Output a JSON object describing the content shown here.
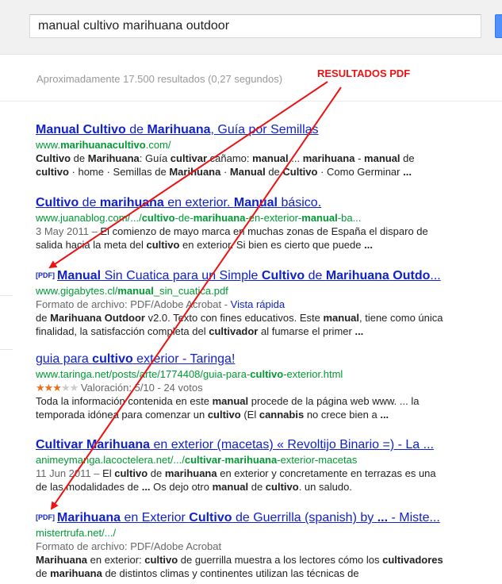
{
  "search": {
    "query": "manual cultivo marihuana outdoor"
  },
  "stats": "Aproximadamente 17.500 resultados (0,27 segundos)",
  "annotation": {
    "label": "RESULTADOS PDF",
    "color": "#ee1111"
  },
  "colors": {
    "title_link": "#1122cc",
    "url_green": "#009933",
    "meta_gray": "#666666"
  },
  "results": [
    {
      "title_html": "<b>Manual Cultivo</b> de <b>Marihuana</b>, Guía por Semillas",
      "url_html": "www.<b>marihuanacultivo</b>.com/",
      "snippet_html": "<b>Cultivo</b> de <b>Marihuana</b>: Guía <b>cultivar</b> cáñamo: <b>manual</b> ... <b>marihuana</b> - <b>manual</b> de <b>cultivo</b> · home · Semillas de <b>Marihuana</b> · <b>Manual</b> de <b>Cultivo</b> · Como Germinar <b>...</b>"
    },
    {
      "title_html": "<b>Cultivo</b> de <b>marihuana</b> en exterior. <b>Manual</b> básico.",
      "url_html": "www.juanablog.com/.../<b>cultivo</b>-de-<b>marihuana</b>-en-exterior-<b>manual</b>-ba...",
      "date": "3 May 2011 – ",
      "snippet_html": "El comienzo de mayo marca en muchas zonas de España el disparo de salida hacia la meta del <b>cultivo</b> en exterior. Si bien es cierto que puede <b>...</b>"
    },
    {
      "pdf_tag": "[PDF]",
      "title_html": "<b>Manual</b> Sin Cuatica para un Simple <b>Cultivo</b> de <b>Marihuana</b> <b>Outdo</b>...",
      "url_html": "www.gigabytes.cl/<b>manual</b>_sin_cuatica.pdf",
      "format": "Formato de archivo: PDF/Adobe Acrobat - ",
      "quick_view": "Vista rápida",
      "snippet_html": "de <b>Marihuana Outdoor</b> v2.0. Texto con fines educativos. Este <b>manual</b>, tiene como única finalidad, la satisfacción completa del <b>cultivador</b> al fumarse el primer <b>...</b>"
    },
    {
      "title_html": "guia para <b>cultivo</b> exterior - Taringa!",
      "url_html": "www.taringa.net/posts/arte/1774408/guia-para-<b>cultivo</b>-exterior.html",
      "rating": 2.5,
      "rating_text": "Valoración: 5/10 - 24 votos",
      "snippet_html": "Toda la información contenida en este <b>manual</b> procede de la página web www. ... la temporada idónea para comenzar un <b>cultivo</b> (El <b>cannabis</b> no crece bien a <b>...</b>"
    },
    {
      "title_html": "<b>Cultivar Marihuana</b> en exterior (macetas) « Revoltijo Binario =) - La ...",
      "url_html": "animeymanga.lacoctelera.net/.../<b>cultivar</b>-<b>marihuana</b>-exterior-macetas",
      "date": "11 Jun 2011 – ",
      "snippet_html": "El <b>cultivo</b> de <b>marihuana</b> en exterior y concretamente en terrazas es una de las modalidades de <b>...</b> Os dejo otro <b>manual</b> de <b>cultivo</b>. un saludo."
    },
    {
      "pdf_tag": "[PDF]",
      "title_html": "<b>Marihuana</b> en Exterior <b>Cultivo</b> de Guerrilla (spanish) by <b>...</b> - Miste...",
      "url_html": "mistertrufa.net/.../",
      "format": "Formato de archivo: PDF/Adobe Acrobat",
      "snippet_html": "<b>Marihuana</b> en exterior: <b>cultivo</b> de guerrilla muestra a los lectores cómo los <b>cultivadores</b> de <b>marihuana</b> de distintos climas y continentes utilizan las técnicas de"
    }
  ]
}
